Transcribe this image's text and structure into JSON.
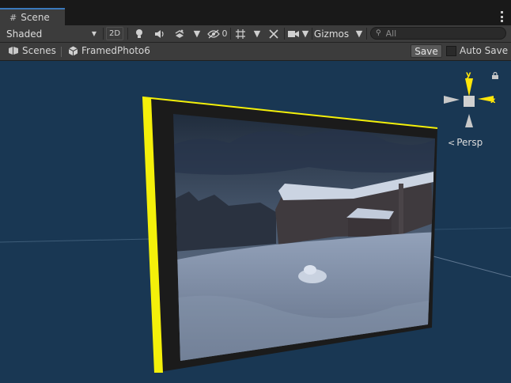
{
  "tab": {
    "icon": "hash-grid-icon",
    "title": "Scene"
  },
  "toolbar": {
    "shading_mode": "Shaded",
    "mode_2d": "2D",
    "hidden_count": "0",
    "gizmos_label": "Gizmos",
    "search_placeholder": "All"
  },
  "breadcrumb": {
    "scenes_label": "Scenes",
    "object_label": "FramedPhoto6"
  },
  "save": {
    "button_label": "Save",
    "auto_save_label": "Auto Save"
  },
  "scene_gizmo": {
    "y_label": "y",
    "x_label": "x",
    "projection_label": "Persp"
  },
  "colors": {
    "viewport_bg": "#193753",
    "selection_outline": "#f4f00a",
    "frame_border": "#1b1b1b",
    "toolbar_bg": "#3c3c3c"
  }
}
